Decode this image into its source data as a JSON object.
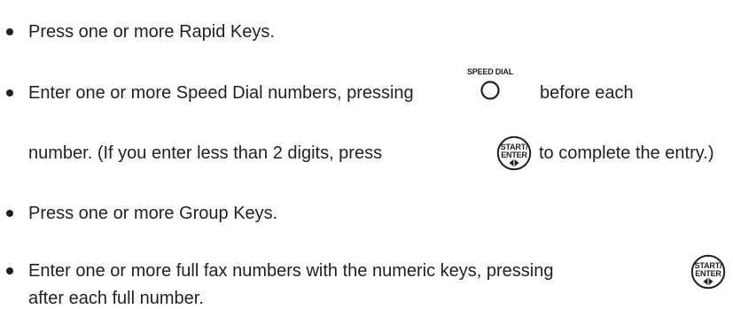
{
  "items": [
    {
      "text": "Press one or more Rapid Keys."
    },
    {
      "line1_before": "Enter one or more Speed Dial numbers, pressing",
      "line1_after": "before each",
      "speed_key_label": "SPEED DIAL",
      "line2_before": "number. (If you enter less than 2 digits, press",
      "line2_after": "to complete the entry.)"
    },
    {
      "text": "Press one or more Group Keys."
    },
    {
      "line1": "Enter one or more full fax numbers with the numeric keys, pressing",
      "line2": "after each full number."
    }
  ],
  "start_enter_key": {
    "line1": "START/",
    "line2": "ENTER",
    "icon": "start-diamond-icon"
  }
}
